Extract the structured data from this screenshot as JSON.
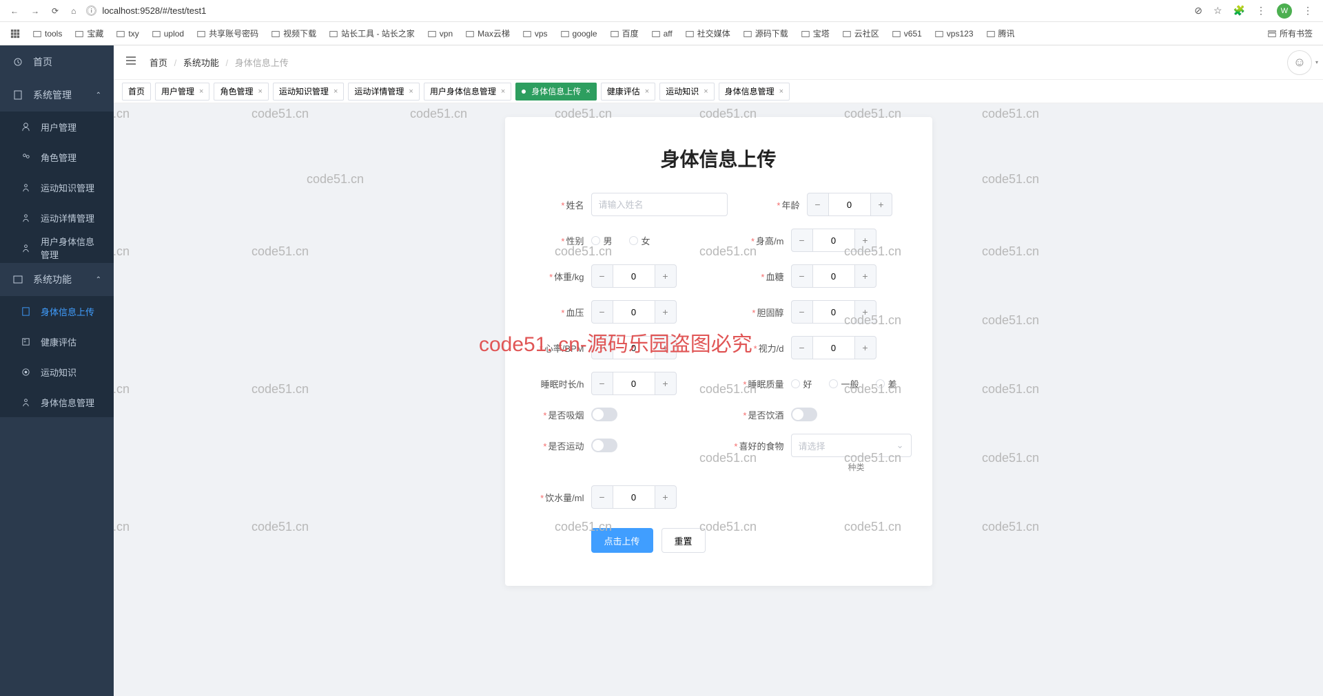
{
  "browser": {
    "url": "localhost:9528/#/test/test1",
    "avatar_letter": "W",
    "all_bookmarks": "所有书签"
  },
  "bookmarks": [
    "tools",
    "宝藏",
    "txy",
    "uplod",
    "共享账号密码",
    "视频下载",
    "站长工具 - 站长之家",
    "vpn",
    "Max云梯",
    "vps",
    "google",
    "百度",
    "aff",
    "社交媒体",
    "源码下载",
    "宝塔",
    "云社区",
    "v651",
    "vps123",
    "腾讯"
  ],
  "sidebar": {
    "home": "首页",
    "sys_mgmt": "系统管理",
    "user_mgmt": "用户管理",
    "role_mgmt": "角色管理",
    "sport_knowledge_mgmt": "运动知识管理",
    "sport_detail_mgmt": "运动详情管理",
    "user_body_mgmt": "用户身体信息管理",
    "sys_func": "系统功能",
    "body_upload": "身体信息上传",
    "health_eval": "健康评估",
    "sport_knowledge": "运动知识",
    "body_info_mgmt": "身体信息管理"
  },
  "breadcrumb": {
    "home": "首页",
    "func": "系统功能",
    "cur": "身体信息上传"
  },
  "tabs": [
    "首页",
    "用户管理",
    "角色管理",
    "运动知识管理",
    "运动详情管理",
    "用户身体信息管理",
    "身体信息上传",
    "健康评估",
    "运动知识",
    "身体信息管理"
  ],
  "active_tab": 6,
  "form": {
    "title": "身体信息上传",
    "name_label": "姓名",
    "name_placeholder": "请输入姓名",
    "age_label": "年龄",
    "age_value": "0",
    "gender_label": "性别",
    "male": "男",
    "female": "女",
    "height_label": "身高/m",
    "height_value": "0",
    "weight_label": "体重/kg",
    "weight_value": "0",
    "sugar_label": "血糖",
    "sugar_value": "0",
    "bp_label": "血压",
    "bp_value": "0",
    "chol_label": "胆固醇",
    "chol_value": "0",
    "hr_label": "心率/BPM",
    "hr_value": "0",
    "vision_label": "视力/d",
    "vision_value": "0",
    "sleep_label": "睡眠时长/h",
    "sleep_value": "0",
    "sleepq_label": "睡眠质量",
    "sq_good": "好",
    "sq_mid": "一般",
    "sq_bad": "差",
    "smoke_label": "是否吸烟",
    "drink_label": "是否饮酒",
    "sport_label": "是否运动",
    "food_label": "喜好的食物",
    "food_placeholder": "请选择",
    "food_sub": "种类",
    "water_label": "饮水量/ml",
    "water_value": "0",
    "submit": "点击上传",
    "reset": "重置"
  },
  "watermark_text": "code51.cn",
  "watermark_main": "code51. cn-源码乐园盗图必究"
}
